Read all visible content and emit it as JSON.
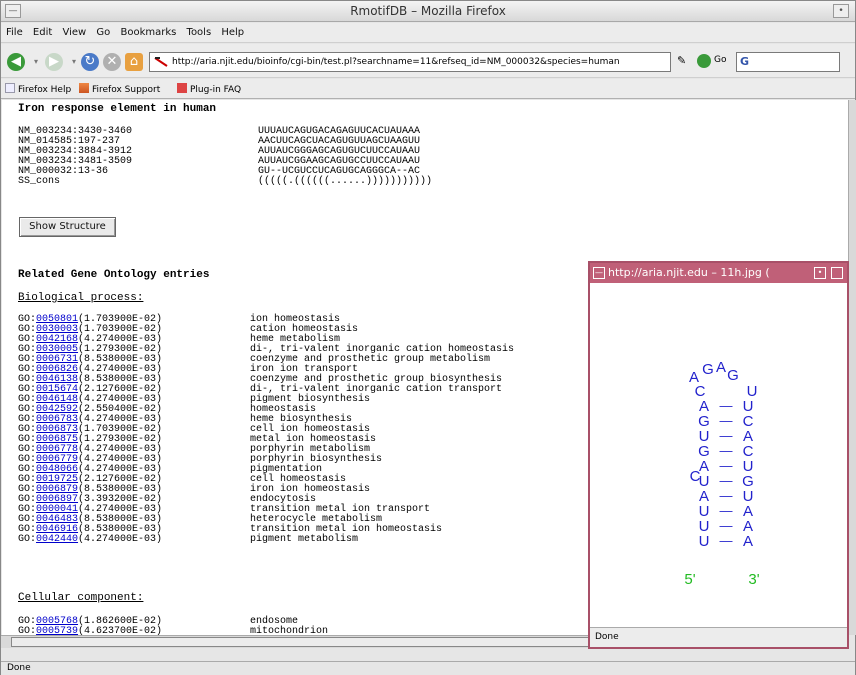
{
  "window": {
    "title": "RmotifDB – Mozilla Firefox"
  },
  "menu": [
    "File",
    "Edit",
    "View",
    "Go",
    "Bookmarks",
    "Tools",
    "Help"
  ],
  "navbar": {
    "url": "http://aria.njit.edu/bioinfo/cgi-bin/test.pl?searchname=11&refseq_id=NM_000032&species=human",
    "go_label": "Go"
  },
  "bookmarks": [
    "Firefox Help",
    "Firefox Support",
    "Plug-in FAQ"
  ],
  "page": {
    "heading": "Iron response element in human",
    "alignment": [
      {
        "id": "NM_003234:3430-3460",
        "seq": "UUUAUCAGUGACAGAGUUCACUAUAAA"
      },
      {
        "id": "NM_014585:197-237",
        "seq": "AACUUCAGCUACAGUGUUAGCUAAGUU"
      },
      {
        "id": "NM_003234:3884-3912",
        "seq": "AUUAUCGGGAGCAGUGUCUUCCAUAAU"
      },
      {
        "id": "NM_003234:3481-3509",
        "seq": "AUUAUCGGAAGCAGUGCCUUCCAUAAU"
      },
      {
        "id": "NM_000032:13-36",
        "seq": "GU--UCGUCCUCAGUGCAGGGCA--AC"
      },
      {
        "id": "SS_cons",
        "seq": "(((((.((((((......)))))))))))"
      }
    ],
    "show_structure_label": "Show Structure",
    "go_heading": "Related Gene Ontology entries",
    "bio_heading": "Biological process:",
    "bio_entries": [
      {
        "id": "0050801",
        "score": "(1.703900E-02)",
        "term": "ion homeostasis"
      },
      {
        "id": "0030003",
        "score": "(1.703900E-02)",
        "term": "cation homeostasis"
      },
      {
        "id": "0042168",
        "score": "(4.274000E-03)",
        "term": "heme metabolism"
      },
      {
        "id": "0030005",
        "score": "(1.279300E-02)",
        "term": "di-, tri-valent inorganic cation homeostasis"
      },
      {
        "id": "0006731",
        "score": "(8.538000E-03)",
        "term": "coenzyme and prosthetic group metabolism"
      },
      {
        "id": "0006826",
        "score": "(4.274000E-03)",
        "term": "iron ion transport"
      },
      {
        "id": "0046138",
        "score": "(8.538000E-03)",
        "term": "coenzyme and prosthetic group biosynthesis"
      },
      {
        "id": "0015674",
        "score": "(2.127600E-02)",
        "term": "di-, tri-valent inorganic cation transport"
      },
      {
        "id": "0046148",
        "score": "(4.274000E-03)",
        "term": "pigment biosynthesis"
      },
      {
        "id": "0042592",
        "score": "(2.550400E-02)",
        "term": "homeostasis"
      },
      {
        "id": "0006783",
        "score": "(4.274000E-03)",
        "term": "heme biosynthesis"
      },
      {
        "id": "0006873",
        "score": "(1.703900E-02)",
        "term": "cell ion homeostasis"
      },
      {
        "id": "0006875",
        "score": "(1.279300E-02)",
        "term": "metal ion homeostasis"
      },
      {
        "id": "0006778",
        "score": "(4.274000E-03)",
        "term": "porphyrin metabolism"
      },
      {
        "id": "0006779",
        "score": "(4.274000E-03)",
        "term": "porphyrin biosynthesis"
      },
      {
        "id": "0048066",
        "score": "(4.274000E-03)",
        "term": "pigmentation"
      },
      {
        "id": "0019725",
        "score": "(2.127600E-02)",
        "term": "cell homeostasis"
      },
      {
        "id": "0006879",
        "score": "(8.538000E-03)",
        "term": "iron ion homeostasis"
      },
      {
        "id": "0006897",
        "score": "(3.393200E-02)",
        "term": "endocytosis"
      },
      {
        "id": "0000041",
        "score": "(4.274000E-03)",
        "term": "transition metal ion transport"
      },
      {
        "id": "0046483",
        "score": "(8.538000E-03)",
        "term": "heterocycle metabolism"
      },
      {
        "id": "0046916",
        "score": "(8.538000E-03)",
        "term": "transition metal ion homeostasis"
      },
      {
        "id": "0042440",
        "score": "(4.274000E-03)",
        "term": "pigment metabolism"
      }
    ],
    "cell_heading": "Cellular component:",
    "cell_entries": [
      {
        "id": "0005768",
        "score": "(1.862600E-02)",
        "term": "endosome"
      },
      {
        "id": "0005739",
        "score": "(4.623700E-02)",
        "term": "mitochondrion"
      }
    ]
  },
  "status": "Done",
  "popup": {
    "title": "http://aria.njit.edu – 11h.jpg (",
    "status": "Done",
    "loop": [
      "A",
      "G",
      "A",
      "G"
    ],
    "pairs": [
      {
        "left": "C",
        "right": "U",
        "bond": ""
      },
      {
        "left": "A",
        "right": "U",
        "bond": "—"
      },
      {
        "left": "G",
        "right": "C",
        "bond": "—"
      },
      {
        "left": "U",
        "right": "A",
        "bond": "—"
      },
      {
        "left": "G",
        "right": "C",
        "bond": "—"
      },
      {
        "left": "A",
        "right": "U",
        "bond": "—"
      },
      {
        "left": "U",
        "right": "G",
        "bond": "—"
      },
      {
        "left": "A",
        "right": "U",
        "bond": "—"
      },
      {
        "left": "U",
        "right": "A",
        "bond": "—"
      },
      {
        "left": "U",
        "right": "A",
        "bond": "—"
      },
      {
        "left": "U",
        "right": "A",
        "bond": "—"
      }
    ],
    "bulge": "C",
    "five_prime": "5'",
    "three_prime": "3'"
  }
}
